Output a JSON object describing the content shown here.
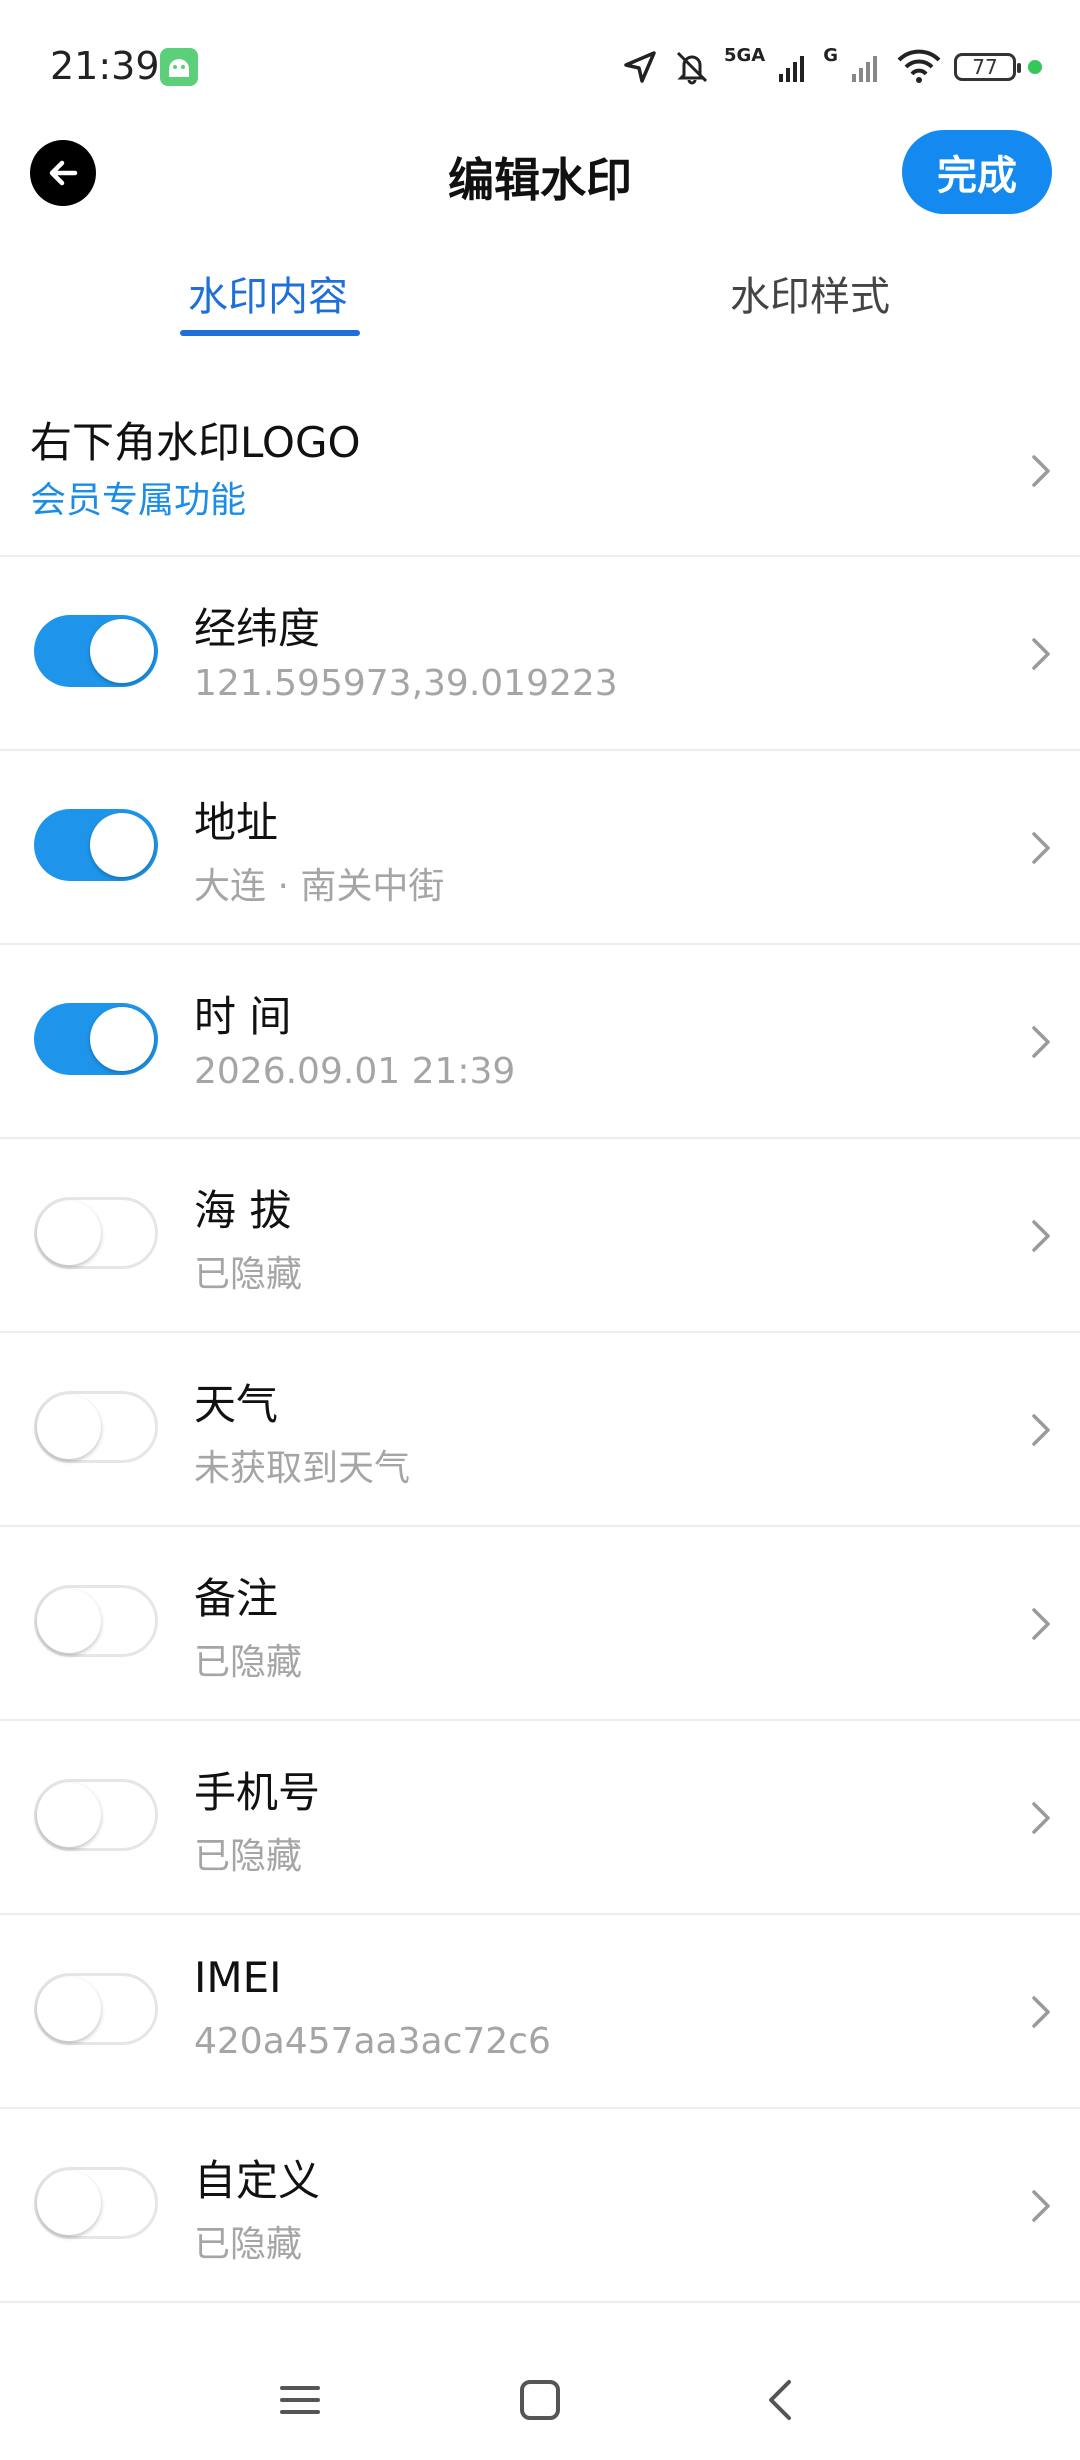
{
  "status_bar": {
    "time": "21:39",
    "network_labels": [
      "5GA",
      "G"
    ],
    "battery": "77"
  },
  "header": {
    "title": "编辑水印",
    "done_label": "完成"
  },
  "tabs": [
    {
      "label": "水印内容",
      "active": true
    },
    {
      "label": "水印样式",
      "active": false
    }
  ],
  "logo_setting": {
    "title": "右下角水印LOGO",
    "subtitle": "会员专属功能"
  },
  "settings": [
    {
      "label": "经纬度",
      "value": "121.595973,39.019223",
      "enabled": true
    },
    {
      "label": "地址",
      "value": "大连 · 南关中街",
      "enabled": true
    },
    {
      "label": "时 间",
      "value": "2026.09.01 21:39",
      "enabled": true
    },
    {
      "label": "海 拔",
      "value": "已隐藏",
      "enabled": false
    },
    {
      "label": "天气",
      "value": "未获取到天气",
      "enabled": false
    },
    {
      "label": "备注",
      "value": "已隐藏",
      "enabled": false
    },
    {
      "label": "手机号",
      "value": "已隐藏",
      "enabled": false
    },
    {
      "label": "IMEI",
      "value": "420a457aa3ac72c6",
      "enabled": false
    },
    {
      "label": "自定义",
      "value": "已隐藏",
      "enabled": false
    }
  ],
  "nav_bar": {
    "icons": [
      "menu-icon",
      "home-icon",
      "back-icon"
    ]
  },
  "colors": {
    "accent": "#1e95ea",
    "tab_active": "#1f6fdb",
    "member_text": "#1c8de6"
  }
}
